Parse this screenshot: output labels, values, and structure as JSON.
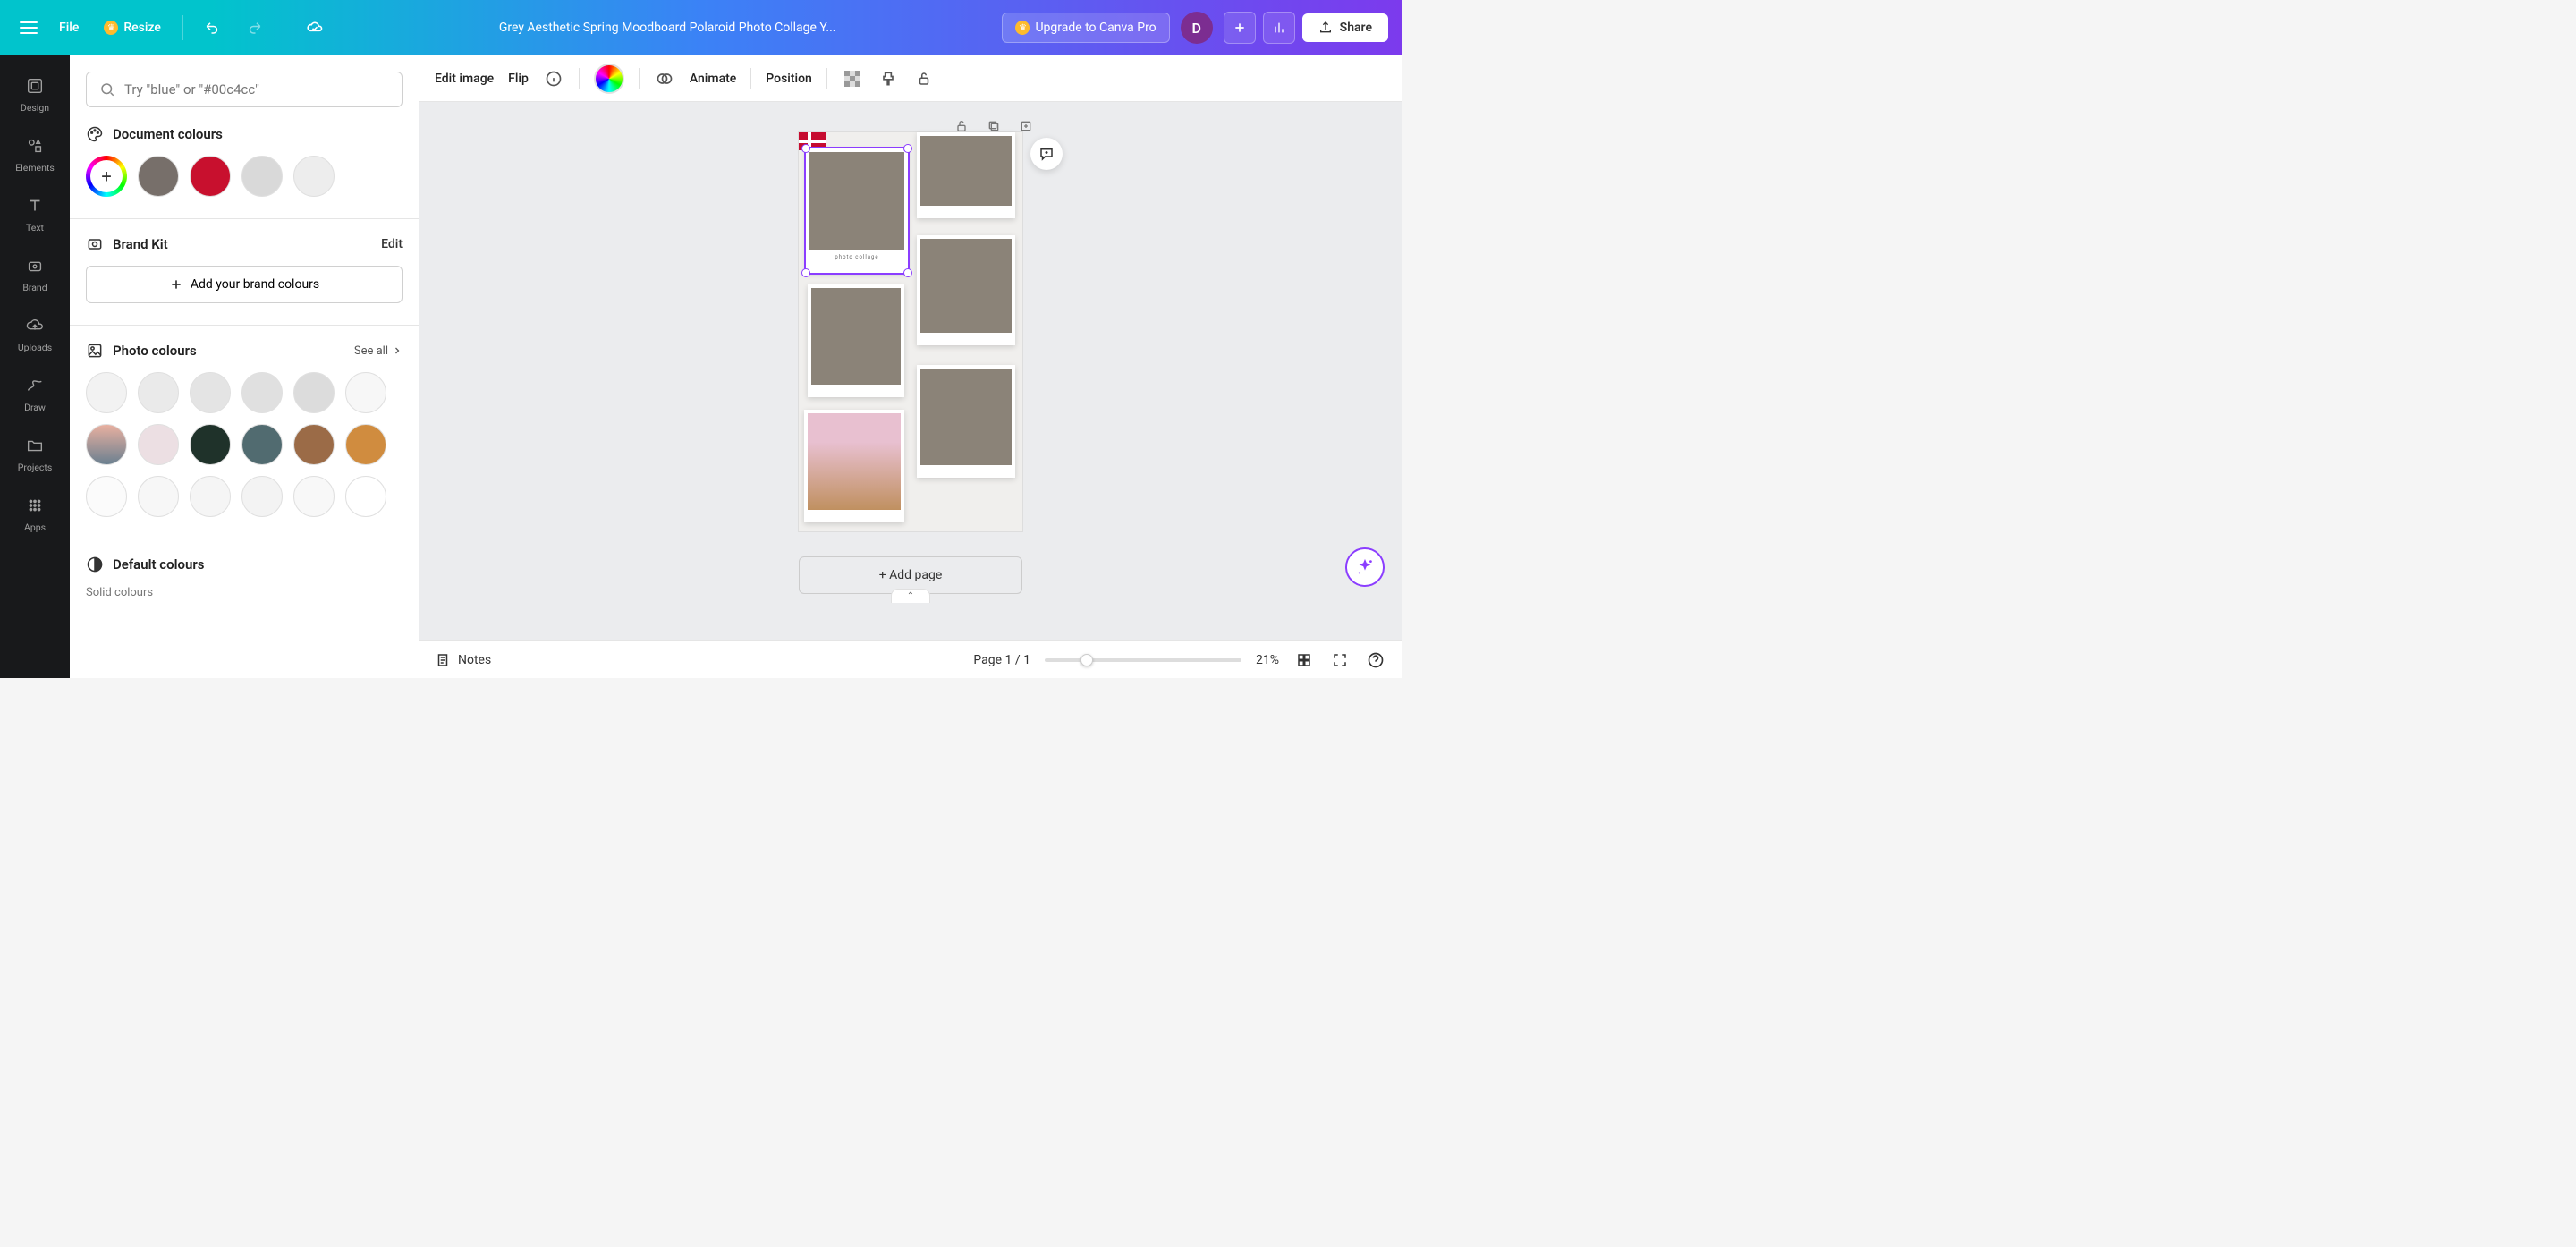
{
  "header": {
    "file": "File",
    "resize": "Resize",
    "title": "Grey Aesthetic Spring Moodboard Polaroid Photo Collage Y...",
    "upgrade": "Upgrade to Canva Pro",
    "avatar_initial": "D",
    "share": "Share"
  },
  "nav": {
    "items": [
      {
        "label": "Design"
      },
      {
        "label": "Elements"
      },
      {
        "label": "Text"
      },
      {
        "label": "Brand"
      },
      {
        "label": "Uploads"
      },
      {
        "label": "Draw"
      },
      {
        "label": "Projects"
      },
      {
        "label": "Apps"
      }
    ]
  },
  "panel": {
    "search_placeholder": "Try \"blue\" or \"#00c4cc\"",
    "doc_colors_title": "Document colours",
    "doc_colors": [
      "#776f6a",
      "#c8102e",
      "#d9d9d9",
      "#ededed"
    ],
    "brand_title": "Brand Kit",
    "brand_edit": "Edit",
    "brand_add": "Add your brand colours",
    "photo_title": "Photo colours",
    "see_all": "See all",
    "photo_row1": [
      "#f2f2f2",
      "#eaeaea",
      "#e4e4e4",
      "#e0e0e0",
      "#dcdcdc",
      "#f7f7f7"
    ],
    "photo_row2": [
      "#b09080",
      "#ecdfe3",
      "#1f322a",
      "#516b70",
      "#9b6b47",
      "#d08c3f"
    ],
    "photo_row3": [
      "#fbfbfb",
      "#f7f7f7",
      "#f5f5f5",
      "#f3f3f3",
      "#f8f8f8",
      "#ffffff"
    ],
    "default_title": "Default colours",
    "solid_sub": "Solid colours"
  },
  "toolbar": {
    "edit_image": "Edit image",
    "flip": "Flip",
    "animate": "Animate",
    "position": "Position"
  },
  "canvas": {
    "caption": "photo collage",
    "add_page": "+ Add page"
  },
  "bottom": {
    "notes": "Notes",
    "page_indicator": "Page 1 / 1",
    "zoom": "21%"
  }
}
